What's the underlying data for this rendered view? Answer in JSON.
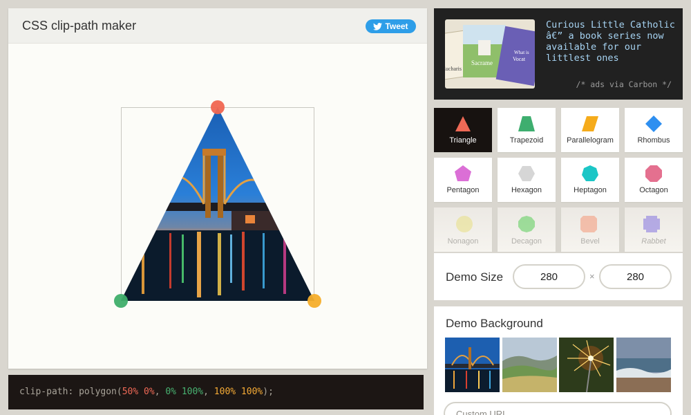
{
  "app": {
    "title": "CSS clip-path maker",
    "tweet_label": "Tweet"
  },
  "code": {
    "prop": "clip-path: polygon(",
    "p1": "50% 0%",
    "sep1": ", ",
    "p2": "0% 100%",
    "sep2": ", ",
    "p3": "100% 100%",
    "end": ");"
  },
  "ad": {
    "text": "Curious Little Catholic â€” a book series now available for our littlest ones",
    "credit": "/* ads via Carbon */",
    "book_titles": [
      "Sacrame",
      "Eucharis",
      "Vocat",
      "What is"
    ]
  },
  "shapes": [
    {
      "label": "Triangle",
      "icon": "triangle-icon",
      "color": "#ee6956",
      "active": true
    },
    {
      "label": "Trapezoid",
      "icon": "trapezoid-icon",
      "color": "#3eae6f"
    },
    {
      "label": "Parallelogram",
      "icon": "parallelogram-icon",
      "color": "#f5ab1b"
    },
    {
      "label": "Rhombus",
      "icon": "rhombus-icon",
      "color": "#2e8ff0"
    },
    {
      "label": "Pentagon",
      "icon": "pentagon-icon",
      "color": "#db6fd6"
    },
    {
      "label": "Hexagon",
      "icon": "hexagon-icon",
      "color": "#d6d6d6"
    },
    {
      "label": "Heptagon",
      "icon": "heptagon-icon",
      "color": "#1cc6c6"
    },
    {
      "label": "Octagon",
      "icon": "octagon-icon",
      "color": "#e4708f"
    },
    {
      "label": "Nonagon",
      "icon": "nonagon-icon",
      "color": "#e8df7a"
    },
    {
      "label": "Decagon",
      "icon": "decagon-icon",
      "color": "#4ccb4c"
    },
    {
      "label": "Bevel",
      "icon": "bevel-icon",
      "color": "#f5906e"
    },
    {
      "label": "Rabbet",
      "icon": "rabbet-icon",
      "color": "#7a69e0"
    }
  ],
  "size": {
    "label": "Demo Size",
    "width": "280",
    "height": "280",
    "times": "×"
  },
  "background": {
    "label": "Demo Background",
    "url_placeholder": "Custom URL"
  },
  "handles": [
    {
      "name": "handle-top",
      "color": "#f06651"
    },
    {
      "name": "handle-bottom-left",
      "color": "#3fae6a"
    },
    {
      "name": "handle-bottom-right",
      "color": "#f6ae2b"
    }
  ]
}
